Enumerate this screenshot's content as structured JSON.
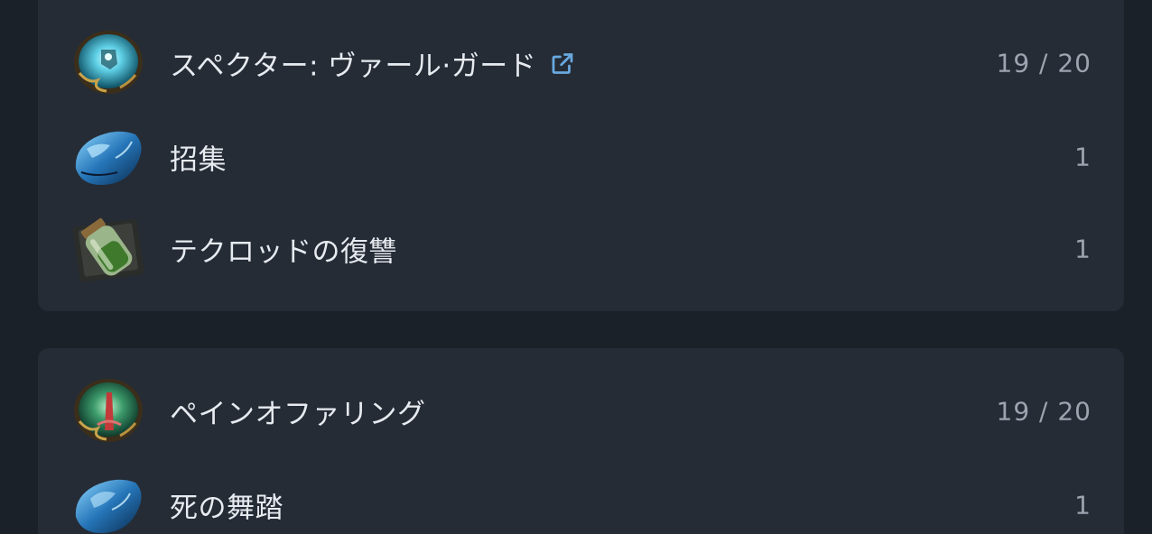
{
  "groups": [
    {
      "rows": [
        {
          "name": "スペクター: ヴァール·ガード",
          "count": "19 / 20",
          "icon": "spectre-gem-icon",
          "link_icon": "external-link-icon"
        },
        {
          "name": "招集",
          "count": "1",
          "icon": "blue-support-gem-icon"
        },
        {
          "name": "テクロッドの復讐",
          "count": "1",
          "icon": "jar-item-icon"
        }
      ]
    },
    {
      "rows": [
        {
          "name": "ペインオファリング",
          "count": "19 / 20",
          "icon": "pain-offering-gem-icon"
        },
        {
          "name": "死の舞踏",
          "count": "1",
          "icon": "blue-support-gem-icon"
        }
      ]
    }
  ],
  "colors": {
    "page_bg": "#1b2129",
    "card_bg": "#252c36",
    "text": "#e7eaef",
    "muted": "#9ca4b0",
    "link": "#6aa9e0"
  }
}
